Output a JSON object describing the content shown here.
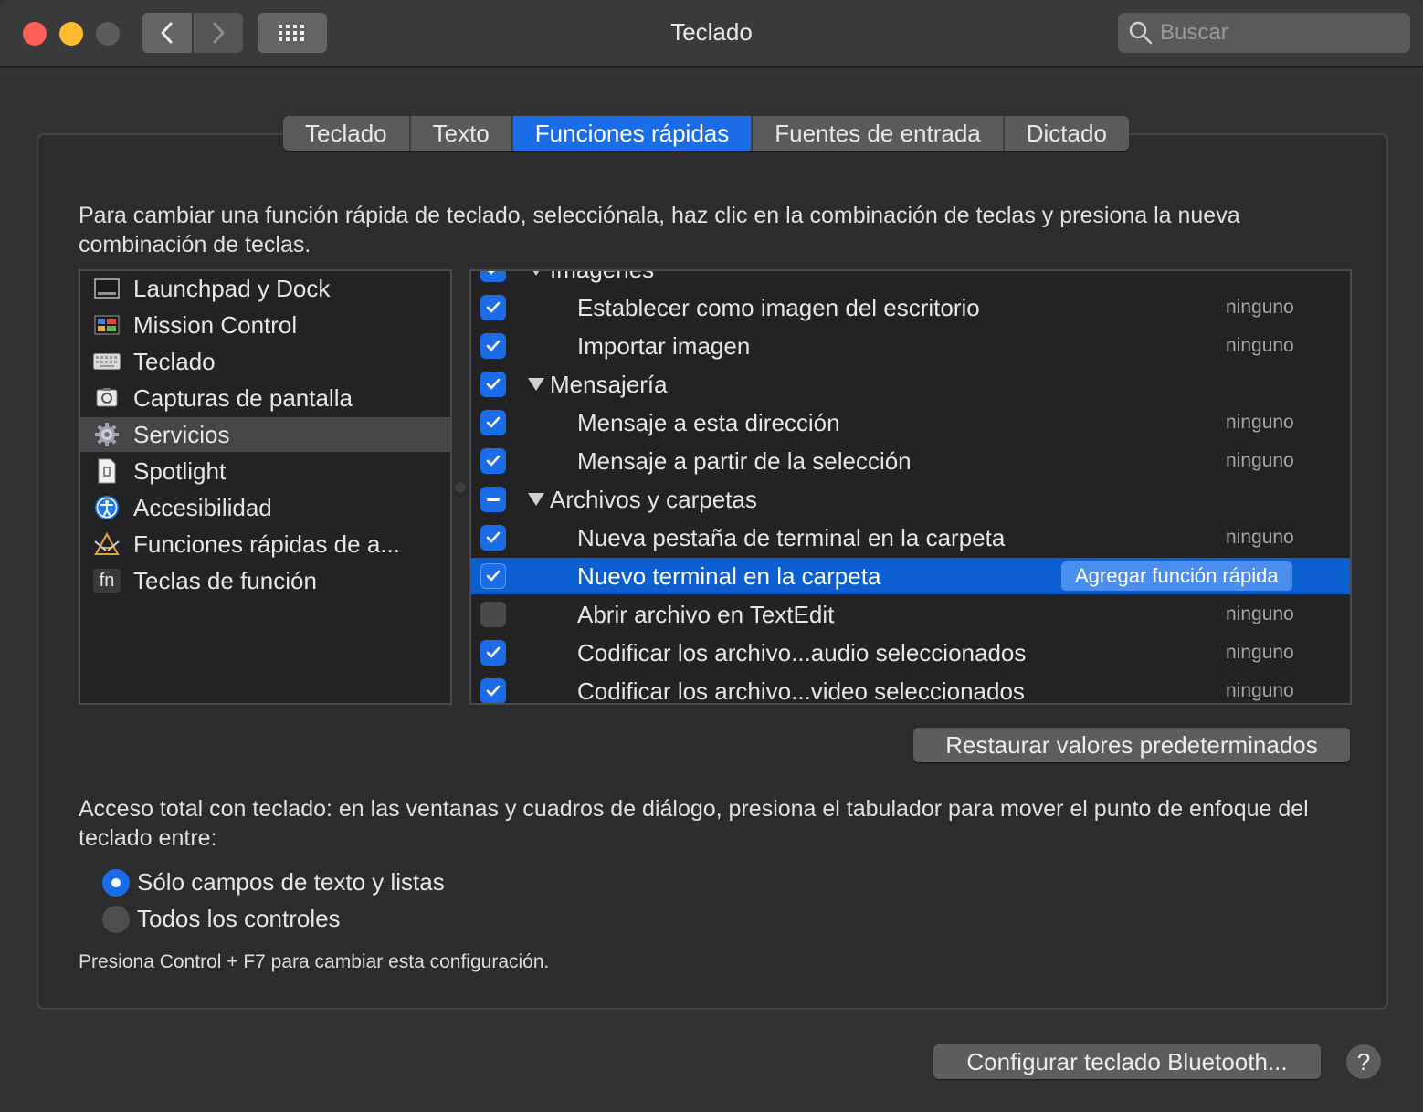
{
  "window": {
    "title": "Teclado",
    "search_placeholder": "Buscar"
  },
  "tabs": [
    {
      "label": "Teclado",
      "active": false
    },
    {
      "label": "Texto",
      "active": false
    },
    {
      "label": "Funciones rápidas",
      "active": true
    },
    {
      "label": "Fuentes de entrada",
      "active": false
    },
    {
      "label": "Dictado",
      "active": false
    }
  ],
  "instructions": "Para cambiar una función rápida de teclado, selecciónala, haz clic en la combinación de teclas y presiona la nueva combinación de teclas.",
  "categories": [
    {
      "label": "Launchpad y Dock",
      "icon": "launchpad-icon"
    },
    {
      "label": "Mission Control",
      "icon": "mission-control-icon"
    },
    {
      "label": "Teclado",
      "icon": "keyboard-icon"
    },
    {
      "label": "Capturas de pantalla",
      "icon": "screenshot-icon"
    },
    {
      "label": "Servicios",
      "icon": "gear-icon",
      "selected": true
    },
    {
      "label": "Spotlight",
      "icon": "spotlight-icon"
    },
    {
      "label": "Accesibilidad",
      "icon": "accessibility-icon"
    },
    {
      "label": "Funciones rápidas de a...",
      "icon": "app-shortcuts-icon"
    },
    {
      "label": "Teclas de función",
      "icon": "fn-key-icon",
      "icon_text": "fn"
    }
  ],
  "shortcuts": [
    {
      "type": "group",
      "label": "Imágenes",
      "checked": "on"
    },
    {
      "type": "item",
      "label": "Establecer como imagen del escritorio",
      "checked": "on",
      "key": "ninguno"
    },
    {
      "type": "item",
      "label": "Importar imagen",
      "checked": "on",
      "key": "ninguno"
    },
    {
      "type": "group",
      "label": "Mensajería",
      "checked": "on"
    },
    {
      "type": "item",
      "label": "Mensaje a esta dirección",
      "checked": "on",
      "key": "ninguno"
    },
    {
      "type": "item",
      "label": "Mensaje a partir de la selección",
      "checked": "on",
      "key": "ninguno"
    },
    {
      "type": "group",
      "label": "Archivos y carpetas",
      "checked": "mixed"
    },
    {
      "type": "item",
      "label": "Nueva pestaña de terminal en la carpeta",
      "checked": "on",
      "key": "ninguno"
    },
    {
      "type": "item",
      "label": "Nuevo terminal en la carpeta",
      "checked": "on",
      "selected": true,
      "button": "Agregar función rápida"
    },
    {
      "type": "item",
      "label": "Abrir archivo en TextEdit",
      "checked": "off",
      "key": "ninguno"
    },
    {
      "type": "item",
      "label": "Codificar los archivo...audio seleccionados",
      "checked": "on",
      "key": "ninguno"
    },
    {
      "type": "item",
      "label": "Codificar los archivo...video seleccionados",
      "checked": "on",
      "key": "ninguno"
    }
  ],
  "restore_button": "Restaurar valores predeterminados",
  "access_text": "Acceso total con teclado: en las ventanas y cuadros de diálogo, presiona el tabulador para mover el punto de enfoque del teclado entre:",
  "radio_options": [
    {
      "label": "Sólo campos de texto y listas",
      "selected": true
    },
    {
      "label": "Todos los controles",
      "selected": false
    }
  ],
  "hint": "Presiona Control + F7 para cambiar esta configuración.",
  "bluetooth_button": "Configurar teclado Bluetooth...",
  "help_label": "?",
  "colors": {
    "accent": "#1a6de6",
    "selection": "#0b5fd1",
    "background": "#323233"
  }
}
